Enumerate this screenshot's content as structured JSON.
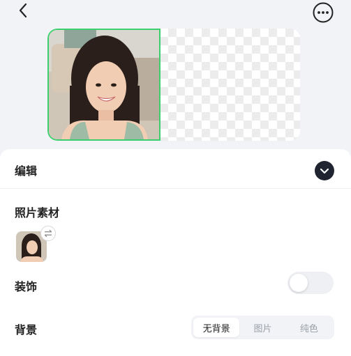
{
  "topbar": {
    "back_icon": "chevron-left-icon",
    "more_icon": "more-horizontal-icon"
  },
  "preview": {
    "selected_border_color": "#3ccf6e",
    "background": "transparent-checkerboard"
  },
  "panel": {
    "edit": {
      "title": "编辑",
      "collapse_icon": "chevron-down-icon"
    },
    "photo_material": {
      "title": "照片素材",
      "swap_icon": "swap-icon"
    },
    "decoration": {
      "title": "装饰",
      "toggle_on": false
    },
    "background": {
      "title": "背景",
      "options": [
        "无背景",
        "图片",
        "纯色"
      ],
      "selected": "无背景"
    }
  },
  "colors": {
    "accent_green": "#3ccf6e",
    "dark_button": "#1f2430"
  }
}
